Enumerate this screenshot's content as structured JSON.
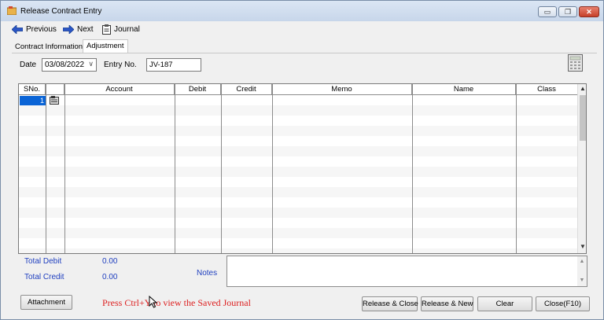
{
  "window": {
    "title": "Release Contract Entry",
    "controls": {
      "minimize": "▭",
      "restore": "❐",
      "close": "✕"
    }
  },
  "toolbar": {
    "previous_label": "Previous",
    "next_label": "Next",
    "journal_label": "Journal"
  },
  "tabs": [
    {
      "label": "Contract Information",
      "active": false
    },
    {
      "label": "Adjustment",
      "active": true
    }
  ],
  "form": {
    "date_label": "Date",
    "date_value": "03/08/2022",
    "entry_no_label": "Entry No.",
    "entry_no_value": "JV-187"
  },
  "grid": {
    "columns": [
      "SNo.",
      "",
      "Account",
      "Debit",
      "Credit",
      "Memo",
      "Name",
      "Class"
    ],
    "rows": [
      {
        "sno": "1",
        "account": "",
        "debit": "",
        "credit": "",
        "memo": "",
        "name": "",
        "class": ""
      }
    ]
  },
  "totals": {
    "total_debit_label": "Total Debit",
    "total_debit_value": "0.00",
    "total_credit_label": "Total Credit",
    "total_credit_value": "0.00",
    "notes_label": "Notes",
    "notes_value": ""
  },
  "footer": {
    "attachment_label": "Attachment",
    "hint_text": "Press Ctrl+Y to view the Saved  Journal",
    "release_close_label": "Release & Close",
    "release_new_label": "Release & New",
    "clear_label": "Clear",
    "close_label": "Close(F10)"
  },
  "colors": {
    "accent": "#0a64d6",
    "label_blue": "#1f3fbf",
    "hint_red": "#dd2222"
  },
  "icons": [
    "app-icon",
    "arrow-left-icon",
    "arrow-right-icon",
    "journal-icon",
    "calculator-icon",
    "row-entry-icon",
    "cursor-icon"
  ]
}
